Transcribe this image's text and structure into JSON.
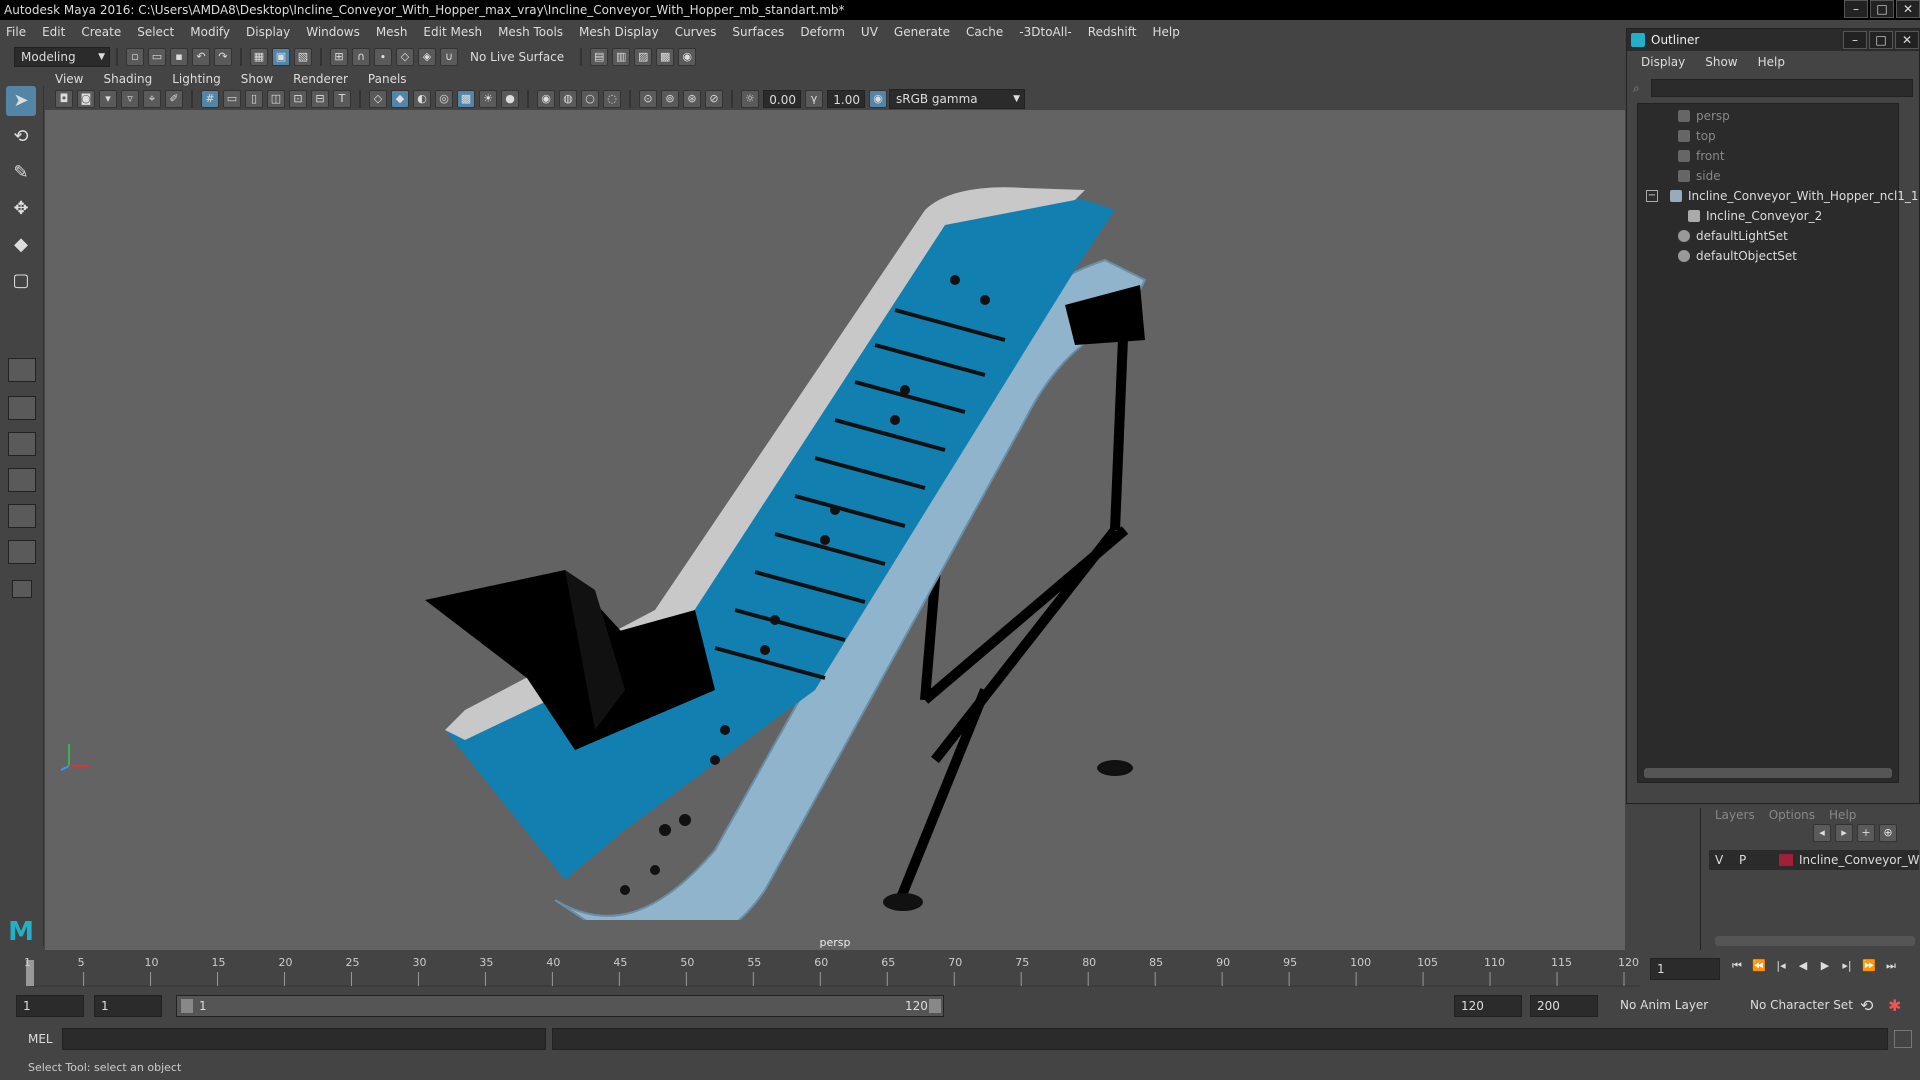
{
  "app": {
    "title": "Autodesk Maya 2016: C:\\Users\\AMDA8\\Desktop\\Incline_Conveyor_With_Hopper_max_vray\\Incline_Conveyor_With_Hopper_mb_standart.mb*"
  },
  "menubar": [
    "File",
    "Edit",
    "Create",
    "Select",
    "Modify",
    "Display",
    "Windows",
    "Mesh",
    "Edit Mesh",
    "Mesh Tools",
    "Mesh Display",
    "Curves",
    "Surfaces",
    "Deform",
    "UV",
    "Generate",
    "Cache",
    "-3DtoAll-",
    "Redshift",
    "Help"
  ],
  "shelf": {
    "mode": "Modeling",
    "live_surface": "No Live Surface"
  },
  "viewport": {
    "menu": [
      "View",
      "Shading",
      "Lighting",
      "Show",
      "Renderer",
      "Panels"
    ],
    "exposure": "0.00",
    "gamma": "1.00",
    "color_space": "sRGB gamma",
    "camera_label": "persp"
  },
  "outliner": {
    "title": "Outliner",
    "menu": [
      "Display",
      "Show",
      "Help"
    ],
    "items": [
      {
        "label": "persp",
        "dim": true
      },
      {
        "label": "top",
        "dim": true
      },
      {
        "label": "front",
        "dim": true
      },
      {
        "label": "side",
        "dim": true
      },
      {
        "label": "Incline_Conveyor_With_Hopper_ncl1_1",
        "dim": false
      },
      {
        "label": "Incline_Conveyor_2",
        "dim": false
      },
      {
        "label": "defaultLightSet",
        "dim": false
      },
      {
        "label": "defaultObjectSet",
        "dim": false
      }
    ]
  },
  "layers": {
    "menu": [
      "Layers",
      "Options",
      "Help"
    ],
    "layer_v": "V",
    "layer_p": "P",
    "layer_name": "Incline_Conveyor_With",
    "layer_color": "#a0203a"
  },
  "timeline": {
    "ticks": [
      "1",
      "5",
      "10",
      "15",
      "20",
      "25",
      "30",
      "35",
      "40",
      "45",
      "50",
      "55",
      "60",
      "65",
      "70",
      "75",
      "80",
      "85",
      "90",
      "95",
      "100",
      "105",
      "110",
      "115",
      "120"
    ],
    "current_frame": "1"
  },
  "range": {
    "start": "1",
    "playback_start": "1",
    "slider_start": "1",
    "slider_end": "120",
    "playback_end": "120",
    "end": "200",
    "anim_layer": "No Anim Layer",
    "character_set": "No Character Set"
  },
  "cmdline": {
    "label": "MEL"
  },
  "helpline": {
    "text": "Select Tool: select an object"
  }
}
